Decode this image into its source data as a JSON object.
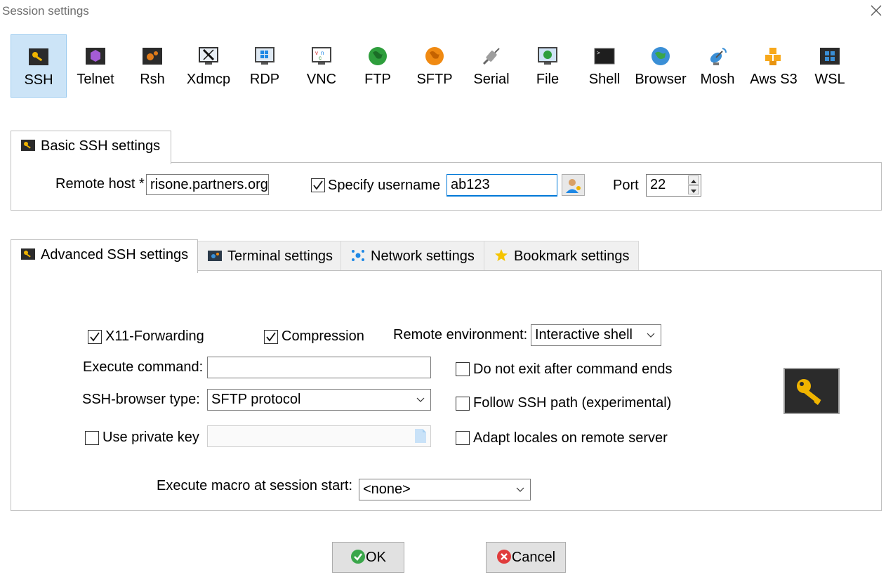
{
  "window": {
    "title": "Session settings"
  },
  "session_types": [
    {
      "label": "SSH",
      "icon": "ssh-key-icon"
    },
    {
      "label": "Telnet",
      "icon": "telnet-icon"
    },
    {
      "label": "Rsh",
      "icon": "rsh-icon"
    },
    {
      "label": "Xdmcp",
      "icon": "xdmcp-icon"
    },
    {
      "label": "RDP",
      "icon": "rdp-icon"
    },
    {
      "label": "VNC",
      "icon": "vnc-icon"
    },
    {
      "label": "FTP",
      "icon": "ftp-globe-icon"
    },
    {
      "label": "SFTP",
      "icon": "sftp-globe-icon"
    },
    {
      "label": "Serial",
      "icon": "serial-plug-icon"
    },
    {
      "label": "File",
      "icon": "file-monitor-icon"
    },
    {
      "label": "Shell",
      "icon": "shell-terminal-icon"
    },
    {
      "label": "Browser",
      "icon": "browser-globe-icon"
    },
    {
      "label": "Mosh",
      "icon": "mosh-satellite-icon"
    },
    {
      "label": "Aws S3",
      "icon": "aws-s3-icon"
    },
    {
      "label": "WSL",
      "icon": "wsl-windows-icon"
    }
  ],
  "basic": {
    "tab_label": "Basic SSH settings",
    "remote_host_label": "Remote host *",
    "remote_host_value": "risone.partners.org",
    "specify_username_label": "Specify username",
    "specify_username_checked": true,
    "username_value": "ab123",
    "port_label": "Port",
    "port_value": "22"
  },
  "tabs": [
    {
      "label": "Advanced SSH settings",
      "icon": "key-icon"
    },
    {
      "label": "Terminal settings",
      "icon": "terminal-settings-icon"
    },
    {
      "label": "Network settings",
      "icon": "network-icon"
    },
    {
      "label": "Bookmark settings",
      "icon": "star-icon"
    }
  ],
  "advanced": {
    "x11_label": "X11-Forwarding",
    "x11_checked": true,
    "compression_label": "Compression",
    "compression_checked": true,
    "remote_env_label": "Remote environment:",
    "remote_env_value": "Interactive shell",
    "execute_command_label": "Execute command:",
    "execute_command_value": "",
    "do_not_exit_label": "Do not exit after command ends",
    "browser_type_label": "SSH-browser type:",
    "browser_type_value": "SFTP protocol",
    "follow_path_label": "Follow SSH path (experimental)",
    "private_key_label": "Use private key",
    "adapt_locales_label": "Adapt locales on remote server",
    "macro_label": "Execute macro at session start:",
    "macro_value": "<none>"
  },
  "buttons": {
    "ok": "OK",
    "cancel": "Cancel"
  },
  "colors": {
    "selected_bg": "#cce4f7",
    "focus_border": "#0078d7",
    "ok_green": "#3aa64a",
    "cancel_red": "#e03c3c"
  }
}
